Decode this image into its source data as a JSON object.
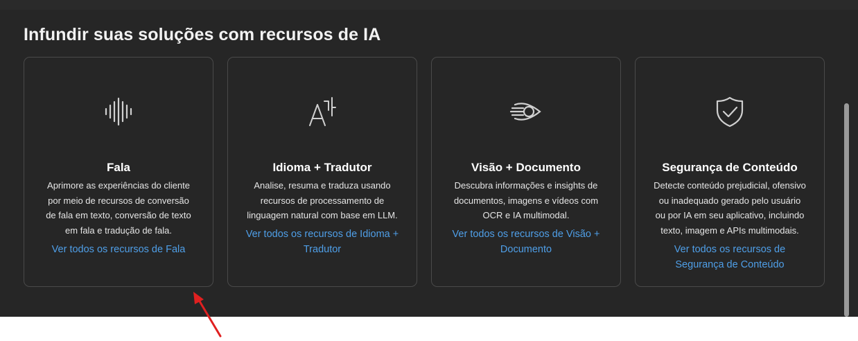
{
  "section": {
    "title": "Infundir suas soluções com recursos de IA"
  },
  "cards": [
    {
      "icon": "speech-waveform-icon",
      "title": "Fala",
      "description": "Aprimore as experiências do cliente por meio de recursos de conversão de fala em texto, conversão de texto em fala e tradução de fala.",
      "link": "Ver todos os recursos de Fala"
    },
    {
      "icon": "language-translator-icon",
      "title": "Idioma + Tradutor",
      "description": "Analise, resuma e traduza usando recursos de processamento de linguagem natural com base em LLM.",
      "link": "Ver todos os recursos de Idioma + Tradutor"
    },
    {
      "icon": "vision-eye-icon",
      "title": "Visão + Documento",
      "description": "Descubra informações e insights de documentos, imagens e vídeos com OCR e IA multimodal.",
      "link": "Ver todos os recursos de Visão + Documento"
    },
    {
      "icon": "shield-check-icon",
      "title": "Segurança de Conteúdo",
      "description": "Detecte conteúdo prejudicial, ofensivo ou inadequado gerado pelo usuário ou por IA em seu aplicativo, incluindo texto, imagem e APIs multimodais.",
      "link": "Ver todos os recursos de Segurança de Conteúdo"
    }
  ],
  "colors": {
    "background": "#262626",
    "card_border": "#4a4a4a",
    "link": "#4f9fe8",
    "annotation_arrow": "#e02020"
  }
}
